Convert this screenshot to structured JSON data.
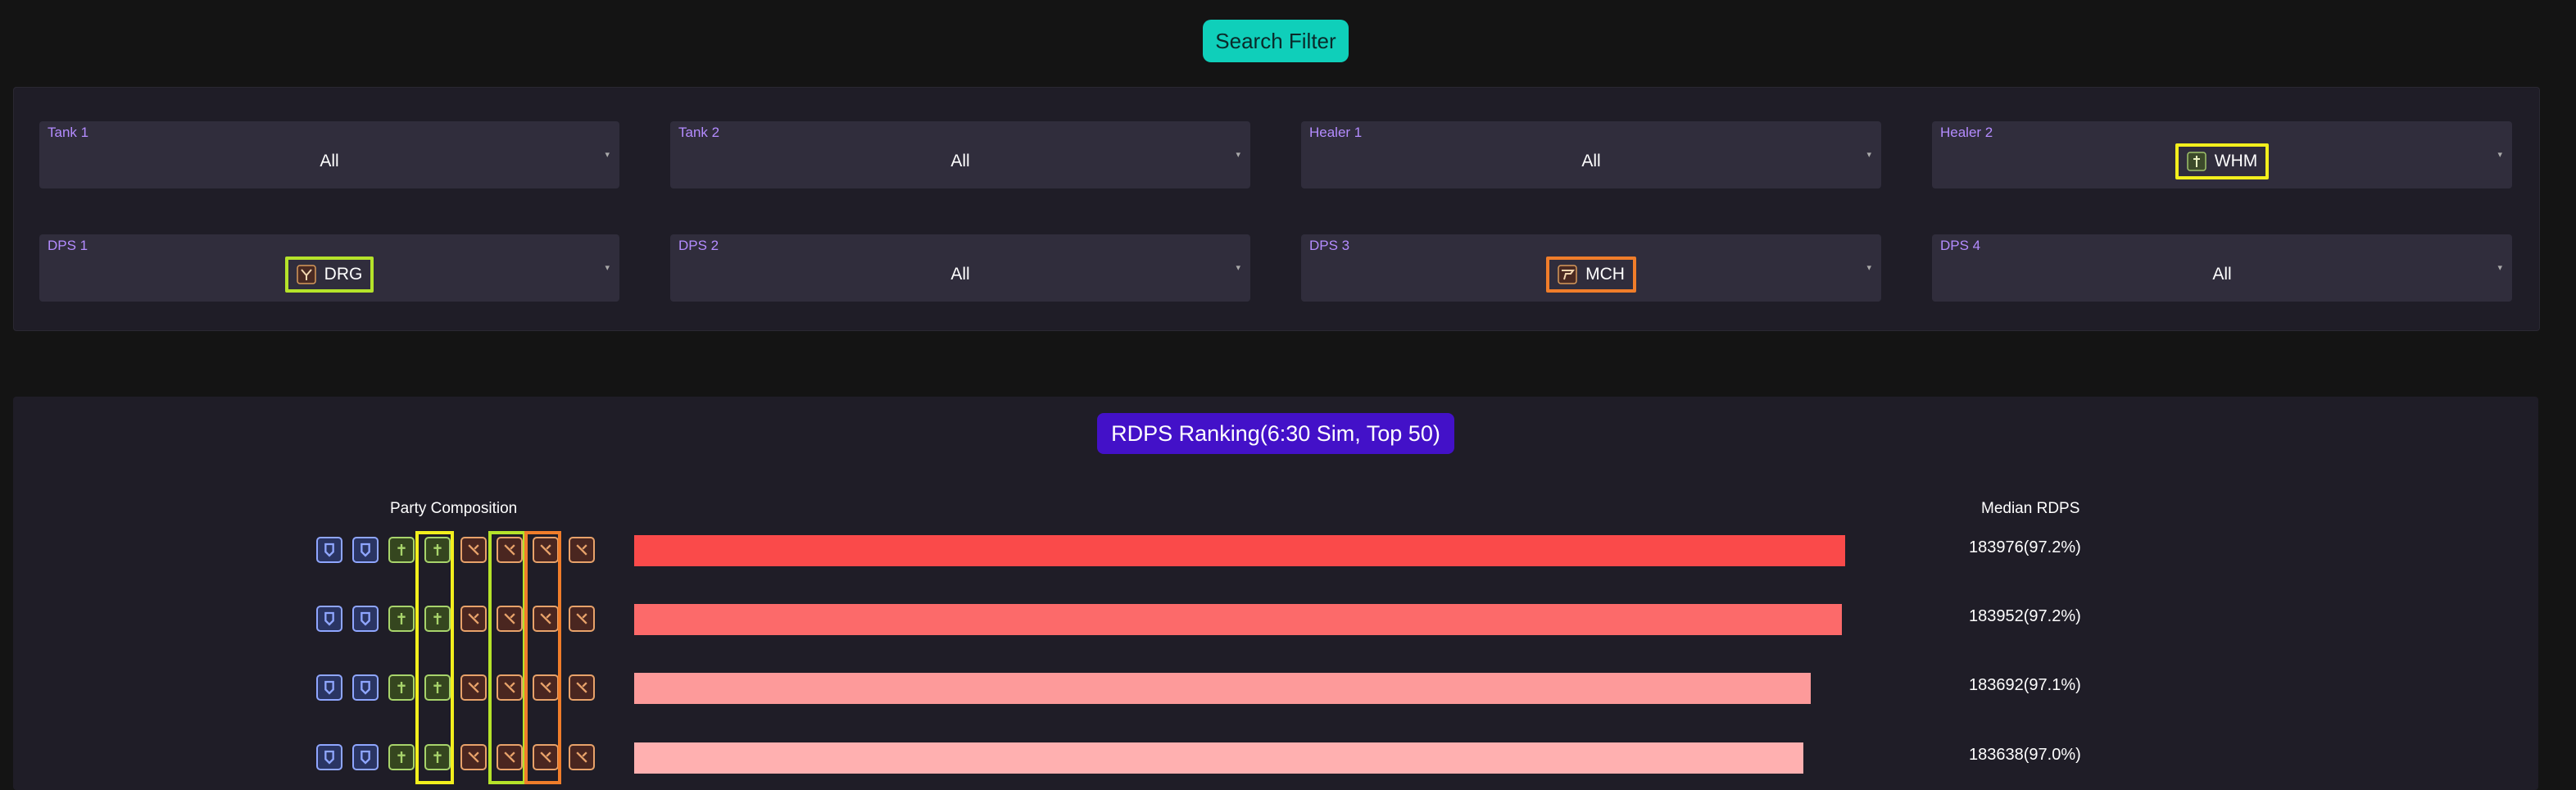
{
  "search_button": {
    "label": "Search Filter"
  },
  "filters": [
    {
      "label": "Tank 1",
      "value": "All"
    },
    {
      "label": "Tank 2",
      "value": "All"
    },
    {
      "label": "Healer 1",
      "value": "All"
    },
    {
      "label": "Healer 2",
      "value": "WHM",
      "icon": "whm-job-icon",
      "highlight": "#f2ef1d"
    },
    {
      "label": "DPS 1",
      "value": "DRG",
      "icon": "drg-job-icon",
      "highlight": "#b5e32a"
    },
    {
      "label": "DPS 2",
      "value": "All"
    },
    {
      "label": "DPS 3",
      "value": "MCH",
      "icon": "mch-job-icon",
      "highlight": "#f07d2a"
    },
    {
      "label": "DPS 4",
      "value": "All"
    }
  ],
  "ranking": {
    "title": "RDPS Ranking(6:30 Sim, Top 50)",
    "party_header": "Party Composition",
    "score_header": "Median RDPS",
    "rows": [
      {
        "icons": [
          "tank-a-icon",
          "tank-b-icon",
          "healer-a-icon",
          "whm-icon",
          "melee-a-icon",
          "drg-icon",
          "mch-icon",
          "caster-icon"
        ],
        "value": 183976,
        "pct": "97.2%",
        "score": "183976(97.2%)",
        "color": "#fa4a4a"
      },
      {
        "icons": [
          "tank-a-icon",
          "tank-c-icon",
          "healer-a-icon",
          "whm-icon",
          "melee-a-icon",
          "drg-icon",
          "mch-icon",
          "caster-icon"
        ],
        "value": 183952,
        "pct": "97.2%",
        "score": "183952(97.2%)",
        "color": "#fc6a6a"
      },
      {
        "icons": [
          "tank-c-icon",
          "tank-c-icon",
          "healer-a-icon",
          "whm-icon",
          "melee-a-icon",
          "drg-icon",
          "mch-icon",
          "caster-icon"
        ],
        "value": 183692,
        "pct": "97.1%",
        "score": "183692(97.1%)",
        "color": "#fd9a9a"
      },
      {
        "icons": [
          "tank-d-icon",
          "tank-b-icon",
          "healer-a-icon",
          "whm-icon",
          "melee-a-icon",
          "drg-icon",
          "mch-icon",
          "caster-icon"
        ],
        "value": 183638,
        "pct": "97.0%",
        "score": "183638(97.0%)",
        "color": "#ffb0b0"
      }
    ]
  },
  "colors": {
    "tank": "#4f6fd1",
    "healer": "#6fb63a",
    "dps": "#d64e3e",
    "whm_highlight": "#f2ef1d",
    "drg_highlight": "#b5e32a",
    "mch_highlight": "#f07d2a"
  }
}
